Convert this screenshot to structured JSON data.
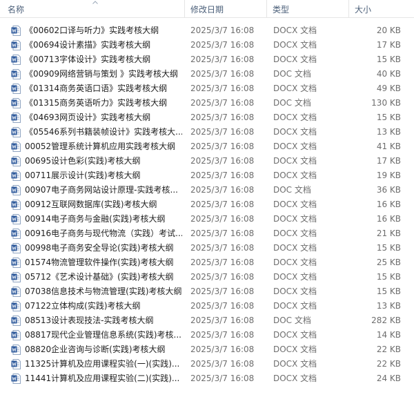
{
  "header": {
    "name_label": "名称",
    "date_label": "修改日期",
    "type_label": "类型",
    "size_label": "大小",
    "sort_icon": "chevron-up-icon"
  },
  "colors": {
    "header_text": "#4c607a",
    "word_blue": "#2b579a",
    "muted_text": "#6d6d6d"
  },
  "files": [
    {
      "name": "《00602口译与听力》实践考核大纲",
      "date": "2025/3/7 16:08",
      "type": "DOCX 文档",
      "size": "20 KB"
    },
    {
      "name": "《00694设计素描》实践考核大纲",
      "date": "2025/3/7 16:08",
      "type": "DOCX 文档",
      "size": "17 KB"
    },
    {
      "name": "《00713字体设计》实践考核大纲",
      "date": "2025/3/7 16:08",
      "type": "DOCX 文档",
      "size": "15 KB"
    },
    {
      "name": "《00909网络营销与策划 》实践考核大纲",
      "date": "2025/3/7 16:08",
      "type": "DOC 文档",
      "size": "40 KB"
    },
    {
      "name": "《01314商务英语口语》实践考核大纲",
      "date": "2025/3/7 16:08",
      "type": "DOCX 文档",
      "size": "49 KB"
    },
    {
      "name": "《01315商务英语听力》实践考核大纲",
      "date": "2025/3/7 16:08",
      "type": "DOC 文档",
      "size": "130 KB"
    },
    {
      "name": "《04693网页设计》实践考核大纲",
      "date": "2025/3/7 16:08",
      "type": "DOCX 文档",
      "size": "15 KB"
    },
    {
      "name": "《05546系列书籍装帧设计》实践考核大...",
      "date": "2025/3/7 16:08",
      "type": "DOCX 文档",
      "size": "13 KB"
    },
    {
      "name": "00052管理系统计算机应用实践考核大纲",
      "date": "2025/3/7 16:08",
      "type": "DOCX 文档",
      "size": "41 KB"
    },
    {
      "name": "00695设计色彩(实践)考核大纲",
      "date": "2025/3/7 16:08",
      "type": "DOCX 文档",
      "size": "17 KB"
    },
    {
      "name": "00711展示设计(实践)考核大纲",
      "date": "2025/3/7 16:08",
      "type": "DOCX 文档",
      "size": "19 KB"
    },
    {
      "name": "00907电子商务网站设计原理-实践考核...",
      "date": "2025/3/7 16:08",
      "type": "DOC 文档",
      "size": "36 KB"
    },
    {
      "name": "00912互联网数据库(实践)考核大纲",
      "date": "2025/3/7 16:08",
      "type": "DOCX 文档",
      "size": "16 KB"
    },
    {
      "name": "00914电子商务与金融(实践)考核大纲",
      "date": "2025/3/7 16:08",
      "type": "DOCX 文档",
      "size": "16 KB"
    },
    {
      "name": "00916电子商务与现代物流（实践）考试...",
      "date": "2025/3/7 16:08",
      "type": "DOCX 文档",
      "size": "21 KB"
    },
    {
      "name": "00998电子商务安全导论(实践)考核大纲",
      "date": "2025/3/7 16:08",
      "type": "DOCX 文档",
      "size": "15 KB"
    },
    {
      "name": "01574物流管理软件操作(实践)考核大纲",
      "date": "2025/3/7 16:08",
      "type": "DOCX 文档",
      "size": "25 KB"
    },
    {
      "name": "05712《艺术设计基础》(实践)考核大纲",
      "date": "2025/3/7 16:08",
      "type": "DOCX 文档",
      "size": "15 KB"
    },
    {
      "name": "07038信息技术与物流管理(实践)考核大纲",
      "date": "2025/3/7 16:08",
      "type": "DOCX 文档",
      "size": "15 KB"
    },
    {
      "name": "07122立体构成(实践)考核大纲",
      "date": "2025/3/7 16:08",
      "type": "DOCX 文档",
      "size": "13 KB"
    },
    {
      "name": "08513设计表现技法-实践考核大纲",
      "date": "2025/3/7 16:08",
      "type": "DOC 文档",
      "size": "282 KB"
    },
    {
      "name": "08817现代企业管理信息系统(实践)考核...",
      "date": "2025/3/7 16:08",
      "type": "DOCX 文档",
      "size": "14 KB"
    },
    {
      "name": "08820企业咨询与诊断(实践)考核大纲",
      "date": "2025/3/7 16:08",
      "type": "DOCX 文档",
      "size": "22 KB"
    },
    {
      "name": "11325计算机及应用课程实验(一)(实践)...",
      "date": "2025/3/7 16:08",
      "type": "DOCX 文档",
      "size": "22 KB"
    },
    {
      "name": "11441计算机及应用课程实验(二)(实践)...",
      "date": "2025/3/7 16:08",
      "type": "DOCX 文档",
      "size": "24 KB"
    }
  ]
}
